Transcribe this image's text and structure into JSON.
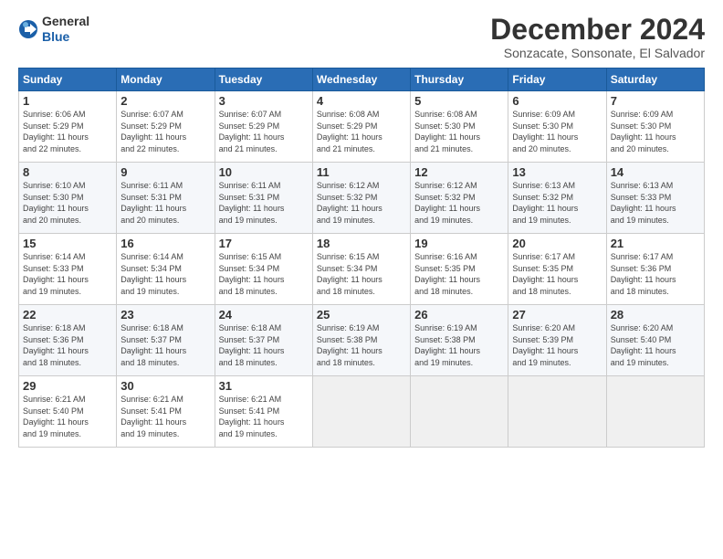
{
  "header": {
    "logo_general": "General",
    "logo_blue": "Blue",
    "title": "December 2024",
    "location": "Sonzacate, Sonsonate, El Salvador"
  },
  "days_of_week": [
    "Sunday",
    "Monday",
    "Tuesday",
    "Wednesday",
    "Thursday",
    "Friday",
    "Saturday"
  ],
  "weeks": [
    [
      {
        "day": "1",
        "info": "Sunrise: 6:06 AM\nSunset: 5:29 PM\nDaylight: 11 hours\nand 22 minutes."
      },
      {
        "day": "2",
        "info": "Sunrise: 6:07 AM\nSunset: 5:29 PM\nDaylight: 11 hours\nand 22 minutes."
      },
      {
        "day": "3",
        "info": "Sunrise: 6:07 AM\nSunset: 5:29 PM\nDaylight: 11 hours\nand 21 minutes."
      },
      {
        "day": "4",
        "info": "Sunrise: 6:08 AM\nSunset: 5:29 PM\nDaylight: 11 hours\nand 21 minutes."
      },
      {
        "day": "5",
        "info": "Sunrise: 6:08 AM\nSunset: 5:30 PM\nDaylight: 11 hours\nand 21 minutes."
      },
      {
        "day": "6",
        "info": "Sunrise: 6:09 AM\nSunset: 5:30 PM\nDaylight: 11 hours\nand 20 minutes."
      },
      {
        "day": "7",
        "info": "Sunrise: 6:09 AM\nSunset: 5:30 PM\nDaylight: 11 hours\nand 20 minutes."
      }
    ],
    [
      {
        "day": "8",
        "info": "Sunrise: 6:10 AM\nSunset: 5:30 PM\nDaylight: 11 hours\nand 20 minutes."
      },
      {
        "day": "9",
        "info": "Sunrise: 6:11 AM\nSunset: 5:31 PM\nDaylight: 11 hours\nand 20 minutes."
      },
      {
        "day": "10",
        "info": "Sunrise: 6:11 AM\nSunset: 5:31 PM\nDaylight: 11 hours\nand 19 minutes."
      },
      {
        "day": "11",
        "info": "Sunrise: 6:12 AM\nSunset: 5:32 PM\nDaylight: 11 hours\nand 19 minutes."
      },
      {
        "day": "12",
        "info": "Sunrise: 6:12 AM\nSunset: 5:32 PM\nDaylight: 11 hours\nand 19 minutes."
      },
      {
        "day": "13",
        "info": "Sunrise: 6:13 AM\nSunset: 5:32 PM\nDaylight: 11 hours\nand 19 minutes."
      },
      {
        "day": "14",
        "info": "Sunrise: 6:13 AM\nSunset: 5:33 PM\nDaylight: 11 hours\nand 19 minutes."
      }
    ],
    [
      {
        "day": "15",
        "info": "Sunrise: 6:14 AM\nSunset: 5:33 PM\nDaylight: 11 hours\nand 19 minutes."
      },
      {
        "day": "16",
        "info": "Sunrise: 6:14 AM\nSunset: 5:34 PM\nDaylight: 11 hours\nand 19 minutes."
      },
      {
        "day": "17",
        "info": "Sunrise: 6:15 AM\nSunset: 5:34 PM\nDaylight: 11 hours\nand 18 minutes."
      },
      {
        "day": "18",
        "info": "Sunrise: 6:15 AM\nSunset: 5:34 PM\nDaylight: 11 hours\nand 18 minutes."
      },
      {
        "day": "19",
        "info": "Sunrise: 6:16 AM\nSunset: 5:35 PM\nDaylight: 11 hours\nand 18 minutes."
      },
      {
        "day": "20",
        "info": "Sunrise: 6:17 AM\nSunset: 5:35 PM\nDaylight: 11 hours\nand 18 minutes."
      },
      {
        "day": "21",
        "info": "Sunrise: 6:17 AM\nSunset: 5:36 PM\nDaylight: 11 hours\nand 18 minutes."
      }
    ],
    [
      {
        "day": "22",
        "info": "Sunrise: 6:18 AM\nSunset: 5:36 PM\nDaylight: 11 hours\nand 18 minutes."
      },
      {
        "day": "23",
        "info": "Sunrise: 6:18 AM\nSunset: 5:37 PM\nDaylight: 11 hours\nand 18 minutes."
      },
      {
        "day": "24",
        "info": "Sunrise: 6:18 AM\nSunset: 5:37 PM\nDaylight: 11 hours\nand 18 minutes."
      },
      {
        "day": "25",
        "info": "Sunrise: 6:19 AM\nSunset: 5:38 PM\nDaylight: 11 hours\nand 18 minutes."
      },
      {
        "day": "26",
        "info": "Sunrise: 6:19 AM\nSunset: 5:38 PM\nDaylight: 11 hours\nand 19 minutes."
      },
      {
        "day": "27",
        "info": "Sunrise: 6:20 AM\nSunset: 5:39 PM\nDaylight: 11 hours\nand 19 minutes."
      },
      {
        "day": "28",
        "info": "Sunrise: 6:20 AM\nSunset: 5:40 PM\nDaylight: 11 hours\nand 19 minutes."
      }
    ],
    [
      {
        "day": "29",
        "info": "Sunrise: 6:21 AM\nSunset: 5:40 PM\nDaylight: 11 hours\nand 19 minutes."
      },
      {
        "day": "30",
        "info": "Sunrise: 6:21 AM\nSunset: 5:41 PM\nDaylight: 11 hours\nand 19 minutes."
      },
      {
        "day": "31",
        "info": "Sunrise: 6:21 AM\nSunset: 5:41 PM\nDaylight: 11 hours\nand 19 minutes."
      },
      {
        "day": "",
        "info": ""
      },
      {
        "day": "",
        "info": ""
      },
      {
        "day": "",
        "info": ""
      },
      {
        "day": "",
        "info": ""
      }
    ]
  ]
}
